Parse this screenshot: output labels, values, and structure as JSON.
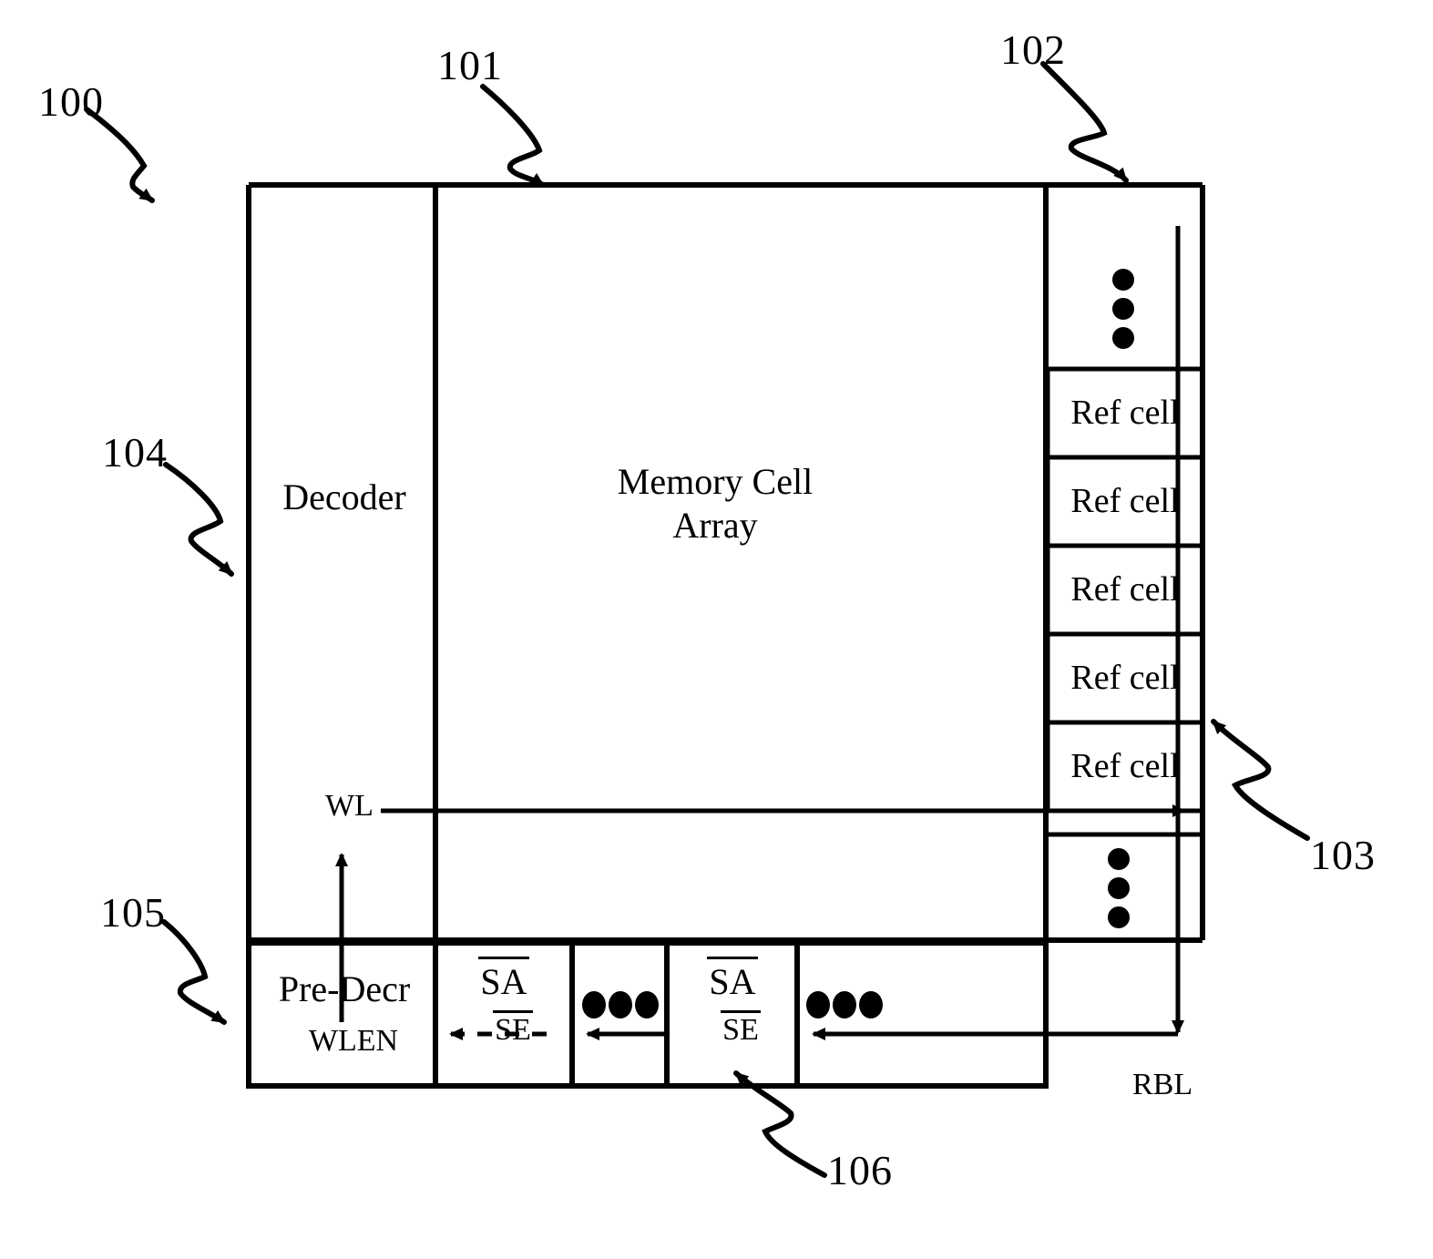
{
  "figure": {
    "kind": "patent-block-diagram",
    "stroke_color": "#000000",
    "background": "#ffffff"
  },
  "reference_numerals": {
    "device": "100",
    "memory_cell_array": "101",
    "ref_cell_column": "102",
    "ref_cell": "103",
    "decoder": "104",
    "pre_decoder": "105",
    "sense_amplifier": "106"
  },
  "blocks": {
    "decoder": {
      "label": "Decoder"
    },
    "memory_array": {
      "line1": "Memory Cell",
      "line2": "Array"
    },
    "pre_decoder": {
      "label": "Pre-Decr",
      "sub_label": "WLEN"
    },
    "sense_amp_1": {
      "label": "SA",
      "enable": "SE"
    },
    "sense_amp_2": {
      "label": "SA",
      "enable": "SE"
    }
  },
  "ref_cells": [
    {
      "label": "Ref cell"
    },
    {
      "label": "Ref cell"
    },
    {
      "label": "Ref cell"
    },
    {
      "label": "Ref cell"
    },
    {
      "label": "Ref cell"
    }
  ],
  "signals": {
    "word_line": "WL",
    "read_bit_line": "RBL",
    "word_line_enable": "WLEN",
    "sense_enable": "SE"
  },
  "ellipses": {
    "ref_column_top": "vertical-ellipsis",
    "ref_column_bottom": "vertical-ellipsis",
    "sense_amp_gap_1": "horizontal-ellipsis",
    "sense_amp_gap_2": "horizontal-ellipsis"
  },
  "icons": {
    "leader_100": "squiggle-arrow-icon",
    "leader_101": "squiggle-arrow-icon",
    "leader_102": "squiggle-arrow-icon",
    "leader_103": "squiggle-arrow-icon",
    "leader_104": "squiggle-arrow-icon",
    "leader_105": "squiggle-arrow-icon",
    "leader_106": "squiggle-arrow-icon",
    "wl_up_arrow": "arrow-up-icon",
    "wl_right_arrow": "arrow-right-icon",
    "rbl_down_arrow": "arrow-down-icon",
    "se_left_arrow_dashed": "arrow-left-dashed-icon",
    "se_left_arrow_1": "arrow-left-icon",
    "se_left_arrow_2": "arrow-left-icon"
  }
}
